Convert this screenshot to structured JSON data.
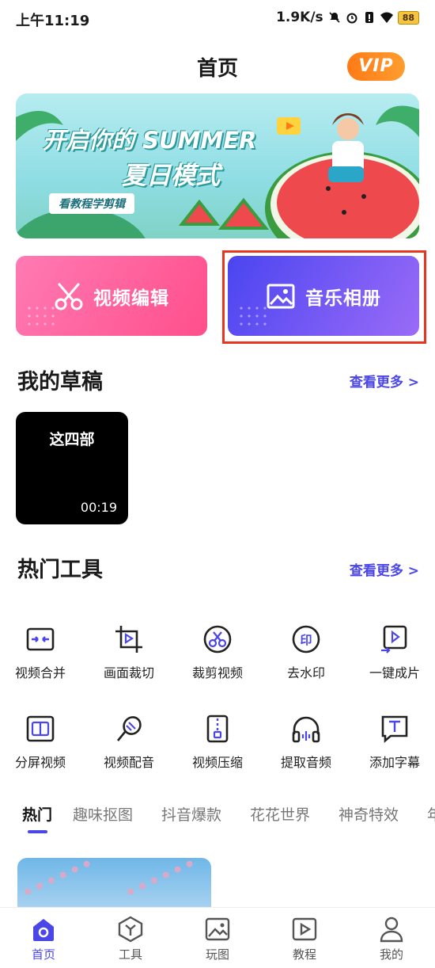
{
  "status_bar": {
    "time": "上午11:19",
    "network_speed": "1.9K/s",
    "battery": "88"
  },
  "header": {
    "title": "首页",
    "vip_label": "VIP"
  },
  "banner": {
    "headline_1": "开启你的 SUMMER",
    "headline_2": "夏日模式",
    "tag": "看教程学剪辑"
  },
  "actions": [
    {
      "label": "视频编辑",
      "icon": "scissors-icon"
    },
    {
      "label": "音乐相册",
      "icon": "image-icon"
    }
  ],
  "drafts": {
    "title": "我的草稿",
    "more": "查看更多 >",
    "items": [
      {
        "title": "这四部",
        "duration": "00:19"
      }
    ]
  },
  "tools": {
    "title": "热门工具",
    "more": "查看更多 >",
    "items": [
      {
        "label": "视频合并",
        "icon": "merge-icon"
      },
      {
        "label": "画面裁切",
        "icon": "crop-icon"
      },
      {
        "label": "裁剪视频",
        "icon": "cut-video-icon"
      },
      {
        "label": "去水印",
        "icon": "watermark-icon"
      },
      {
        "label": "一键成片",
        "icon": "one-click-icon"
      },
      {
        "label": "分屏视频",
        "icon": "split-screen-icon"
      },
      {
        "label": "视频配音",
        "icon": "microphone-icon"
      },
      {
        "label": "视频压缩",
        "icon": "compress-icon"
      },
      {
        "label": "提取音频",
        "icon": "headphones-icon"
      },
      {
        "label": "添加字幕",
        "icon": "subtitle-icon"
      }
    ]
  },
  "tabs": [
    "热门",
    "趣味抠图",
    "抖音爆款",
    "花花世界",
    "神奇特效",
    "年"
  ],
  "bottom_nav": [
    {
      "label": "首页",
      "icon": "home-icon",
      "active": true
    },
    {
      "label": "工具",
      "icon": "toolbox-icon",
      "active": false
    },
    {
      "label": "玩图",
      "icon": "picture-icon",
      "active": false
    },
    {
      "label": "教程",
      "icon": "play-tutorial-icon",
      "active": false
    },
    {
      "label": "我的",
      "icon": "profile-icon",
      "active": false
    }
  ],
  "colors": {
    "accent": "#4a46e8",
    "vip": "#ff8a1f",
    "video_card": "#ff5a94",
    "music_card": "#5a4ef2",
    "highlight": "#e8351f"
  }
}
